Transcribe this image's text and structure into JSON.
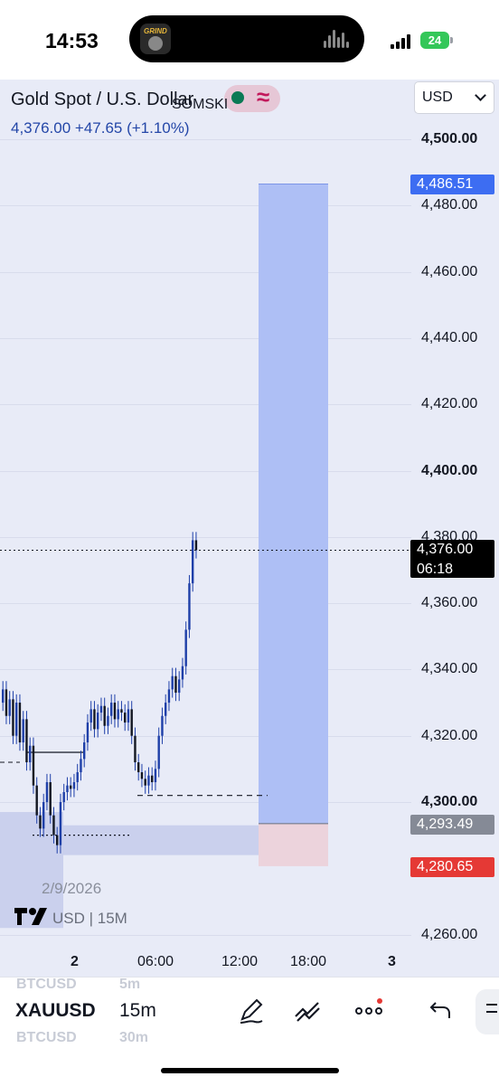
{
  "status_bar": {
    "time": "14:53",
    "island_app_label": "GRIND",
    "battery": "24"
  },
  "chart": {
    "title": "Gold Spot / U.S. Dollar",
    "price_line": "4,376.00  +47.65 (+1.10%)",
    "indicator_name": "SOMSKI",
    "currency": "USD",
    "date_label": "2/9/2026",
    "symbol_label": "USD | 15M",
    "accent_color": "#2962ff",
    "candle_color": "#1e3fa8",
    "price_axis": [
      {
        "label": "4,500.00",
        "value": 4500,
        "strong": true
      },
      {
        "label": "4,480.00",
        "value": 4480,
        "strong": false
      },
      {
        "label": "4,460.00",
        "value": 4460,
        "strong": false
      },
      {
        "label": "4,440.00",
        "value": 4440,
        "strong": false
      },
      {
        "label": "4,420.00",
        "value": 4420,
        "strong": false
      },
      {
        "label": "4,400.00",
        "value": 4400,
        "strong": true
      },
      {
        "label": "4,380.00",
        "value": 4380,
        "strong": false
      },
      {
        "label": "4,360.00",
        "value": 4360,
        "strong": false
      },
      {
        "label": "4,340.00",
        "value": 4340,
        "strong": false
      },
      {
        "label": "4,320.00",
        "value": 4320,
        "strong": false
      },
      {
        "label": "4,300.00",
        "value": 4300,
        "strong": true
      },
      {
        "label": "4,260.00",
        "value": 4260,
        "strong": false
      }
    ],
    "price_tags": {
      "target": {
        "label": "4,486.51",
        "color": "#3d6df2"
      },
      "current": {
        "price": "4,376.00",
        "countdown": "06:18",
        "color": "#000000"
      },
      "entry": {
        "label": "4,293.49",
        "color": "#858a96"
      },
      "stop": {
        "label": "4,280.65",
        "color": "#e53935"
      }
    },
    "time_axis": [
      {
        "label": "2",
        "strong": true
      },
      {
        "label": "06:00",
        "strong": false
      },
      {
        "label": "12:00",
        "strong": false
      },
      {
        "label": "18:00",
        "strong": false
      },
      {
        "label": "3",
        "strong": true
      }
    ]
  },
  "toolbar": {
    "ghost_symbol_above": "BTCUSD",
    "ghost_interval_above": "5m",
    "symbol": "XAUUSD",
    "interval": "15m",
    "ghost_symbol_below": "BTCUSD",
    "ghost_interval_below": "30m",
    "icons": [
      "pen-icon",
      "chart-style-icon",
      "more-icon",
      "undo-icon"
    ]
  }
}
